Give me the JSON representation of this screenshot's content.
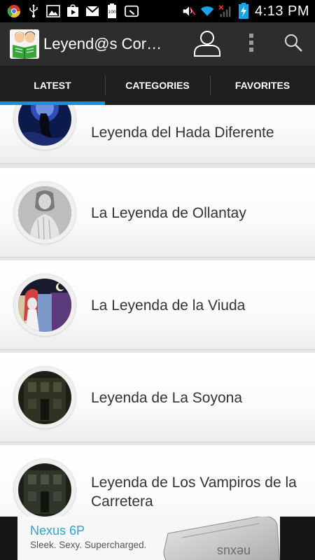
{
  "status_bar": {
    "time": "4:13 PM",
    "battery_level_label": "100",
    "icons": [
      "chrome-icon",
      "usb-icon",
      "gallery-icon",
      "play-store-icon",
      "gmail-icon",
      "battery-100-icon",
      "quick-settings-icon",
      "mute-icon",
      "wifi-icon",
      "no-signal-icon",
      "charging-battery-icon"
    ]
  },
  "action_bar": {
    "title": "Leyend@s Cor…",
    "icons": [
      "app-logo",
      "profile-icon",
      "overflow-menu-icon",
      "search-icon"
    ]
  },
  "tabs": [
    {
      "label": "LATEST",
      "active": true
    },
    {
      "label": "CATEGORIES",
      "active": false
    },
    {
      "label": "FAVORITES",
      "active": false
    }
  ],
  "list": {
    "items": [
      {
        "title": "Leyenda del Hada Diferente"
      },
      {
        "title": "La Leyenda de Ollantay"
      },
      {
        "title": "La Leyenda de la Viuda"
      },
      {
        "title": "Leyenda de La Soyona"
      },
      {
        "title": "Leyenda de Los Vampiros de la Carretera"
      }
    ]
  },
  "ad": {
    "title": "Nexus 6P",
    "subtitle": "Sleek. Sexy. Supercharged.",
    "phone_text": "nexus"
  },
  "colors": {
    "accent": "#1e8fd6",
    "action_bar": "#2d2d2d",
    "tab_bar": "#1f1f1f",
    "ad_title": "#2aa3d6"
  }
}
